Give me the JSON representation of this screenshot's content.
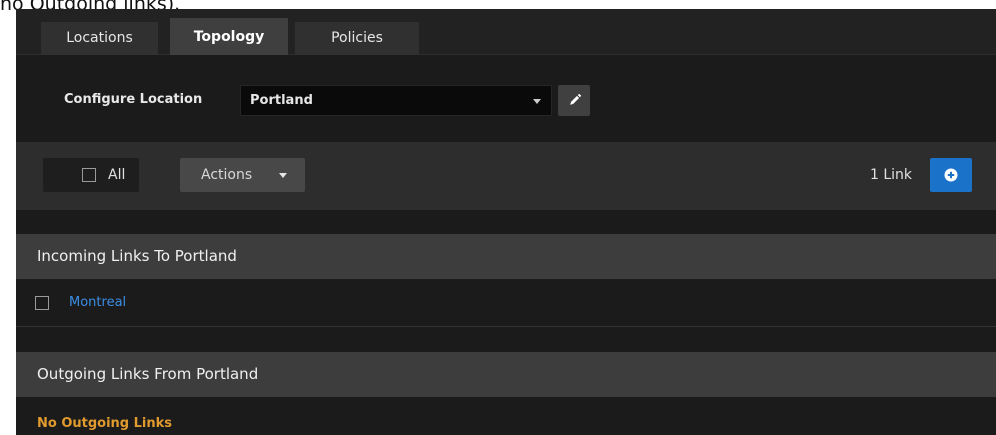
{
  "caption": "no Outgoing links).",
  "tabs": [
    {
      "label": "Locations",
      "active": false
    },
    {
      "label": "Topology",
      "active": true
    },
    {
      "label": "Policies",
      "active": false
    }
  ],
  "configure": {
    "label": "Configure Location",
    "selected_location": "Portland",
    "edit_icon": "pencil-icon",
    "dropdown_icon": "caret-down-icon"
  },
  "toolbar": {
    "select_all_label": "All",
    "select_all_checked": false,
    "actions_label": "Actions",
    "link_count": "1 Link",
    "add_icon": "plus-circle-icon"
  },
  "incoming": {
    "title": "Incoming Links To Portland",
    "links": [
      {
        "name": "Montreal",
        "checked": false
      }
    ]
  },
  "outgoing": {
    "title": "Outgoing Links From Portland",
    "empty_message": "No Outgoing Links"
  },
  "colors": {
    "accent": "#1a72c9",
    "link": "#3a8ee6",
    "warning": "#e09a2e",
    "panel_bg": "#1b1b1b"
  }
}
